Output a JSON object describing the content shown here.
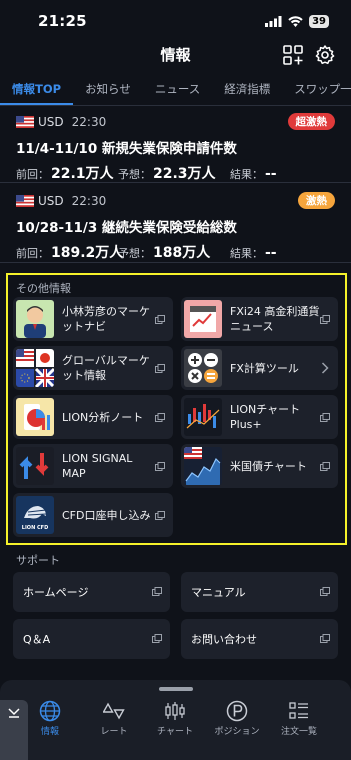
{
  "status": {
    "time": "21:25",
    "battery": "39"
  },
  "header": {
    "title": "情報"
  },
  "tabs": [
    {
      "label": "情報TOP"
    },
    {
      "label": "お知らせ"
    },
    {
      "label": "ニュース"
    },
    {
      "label": "経済指標"
    },
    {
      "label": "スワップ一"
    }
  ],
  "news": [
    {
      "currency": "USD",
      "time": "22:30",
      "badge": "超激熱",
      "title": "11/4-11/10 新規失業保険申請件数",
      "prev_label": "前回：",
      "prev_value": "22.1万人",
      "forecast_label": "予想：",
      "forecast_value": "22.3万人",
      "result_label": "結果：",
      "result_value": "--"
    },
    {
      "currency": "USD",
      "time": "22:30",
      "badge": "激熱",
      "title": "10/28-11/3 継続失業保険受給総数",
      "prev_label": "前回：",
      "prev_value": "189.2万人",
      "forecast_label": "予想：",
      "forecast_value": "188万人",
      "result_label": "結果：",
      "result_value": "--"
    }
  ],
  "other": {
    "title": "その他情報",
    "cards": [
      {
        "label": "小林芳彦のマーケットナビ"
      },
      {
        "label": "FXi24 高金利通貨ニュース"
      },
      {
        "label": "グローバルマーケット情報"
      },
      {
        "label": "FX計算ツール"
      },
      {
        "label": "LION分析ノート"
      },
      {
        "label": "LIONチャートPlus+"
      },
      {
        "label": "LION SIGNAL MAP"
      },
      {
        "label": "米国債チャート"
      },
      {
        "label": "CFD口座申し込み"
      }
    ],
    "logo_text": "LION CFD"
  },
  "support": {
    "title": "サポート",
    "cards": [
      {
        "label": "ホームページ"
      },
      {
        "label": "マニュアル"
      },
      {
        "label": "Q＆A"
      },
      {
        "label": "お問い合わせ"
      }
    ]
  },
  "nav": [
    {
      "label": "情報",
      "icon": "globe-icon"
    },
    {
      "label": "レート",
      "icon": "rate-icon"
    },
    {
      "label": "チャート",
      "icon": "candlestick-icon"
    },
    {
      "label": "ポジション",
      "icon": "position-icon"
    },
    {
      "label": "注文一覧",
      "icon": "list-icon"
    }
  ],
  "colors": {
    "accent": "#3b8be8",
    "highlight": "#f5f22a",
    "badge_red": "#e03a3a",
    "badge_orange": "#f6a53c"
  }
}
